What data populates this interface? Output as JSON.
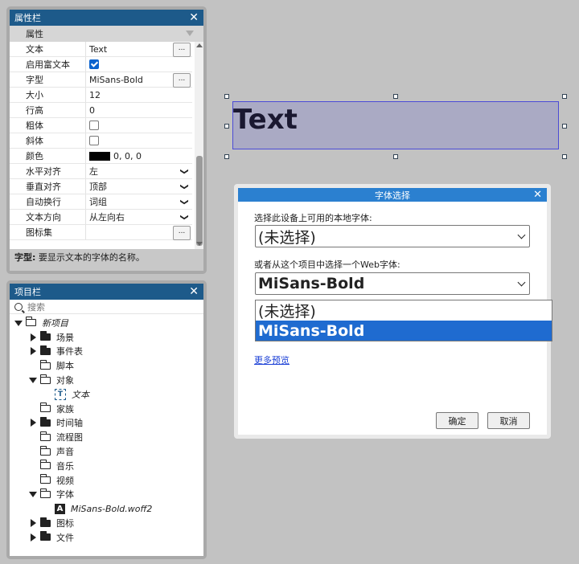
{
  "properties_panel": {
    "title": "属性栏",
    "header": "属性",
    "rows": [
      {
        "key": "文本",
        "value": "Text",
        "control": "button",
        "button": "..."
      },
      {
        "key": "启用富文本",
        "value": "",
        "control": "checkbox",
        "checked": true
      },
      {
        "key": "字型",
        "value": "MiSans-Bold",
        "control": "button",
        "button": "..."
      },
      {
        "key": "大小",
        "value": "12",
        "control": "none"
      },
      {
        "key": "行高",
        "value": "0",
        "control": "none"
      },
      {
        "key": "粗体",
        "value": "",
        "control": "checkbox",
        "checked": false
      },
      {
        "key": "斜体",
        "value": "",
        "control": "checkbox",
        "checked": false
      },
      {
        "key": "颜色",
        "value": "0, 0, 0",
        "control": "color",
        "color": "#000000"
      },
      {
        "key": "水平对齐",
        "value": "左",
        "control": "select"
      },
      {
        "key": "垂直对齐",
        "value": "顶部",
        "control": "select"
      },
      {
        "key": "自动换行",
        "value": "词组",
        "control": "select"
      },
      {
        "key": "文本方向",
        "value": "从左向右",
        "control": "select"
      },
      {
        "key": "图标集",
        "value": "",
        "control": "button",
        "button": "..."
      }
    ],
    "help_label": "字型:",
    "help_text": " 要显示文本的字体的名称。"
  },
  "project_panel": {
    "title": "项目栏",
    "search_placeholder": "搜索",
    "tree": [
      {
        "label": "新项目",
        "indent": 0,
        "toggle": "open",
        "icon": "folder",
        "italic": true
      },
      {
        "label": "场景",
        "indent": 1,
        "toggle": "closed",
        "icon": "folder-filled"
      },
      {
        "label": "事件表",
        "indent": 1,
        "toggle": "closed",
        "icon": "folder-filled"
      },
      {
        "label": "脚本",
        "indent": 1,
        "toggle": "none",
        "icon": "folder"
      },
      {
        "label": "对象",
        "indent": 1,
        "toggle": "open",
        "icon": "folder"
      },
      {
        "label": "文本",
        "indent": 2,
        "toggle": "none",
        "icon": "text-object",
        "italic": true
      },
      {
        "label": "家族",
        "indent": 1,
        "toggle": "none",
        "icon": "folder"
      },
      {
        "label": "时间轴",
        "indent": 1,
        "toggle": "closed",
        "icon": "folder-filled"
      },
      {
        "label": "流程图",
        "indent": 1,
        "toggle": "none",
        "icon": "folder"
      },
      {
        "label": "声音",
        "indent": 1,
        "toggle": "none",
        "icon": "folder"
      },
      {
        "label": "音乐",
        "indent": 1,
        "toggle": "none",
        "icon": "folder"
      },
      {
        "label": "视频",
        "indent": 1,
        "toggle": "none",
        "icon": "folder"
      },
      {
        "label": "字体",
        "indent": 1,
        "toggle": "open",
        "icon": "folder"
      },
      {
        "label": "MiSans-Bold.woff2",
        "indent": 2,
        "toggle": "none",
        "icon": "font-file",
        "italic": true
      },
      {
        "label": "图标",
        "indent": 1,
        "toggle": "closed",
        "icon": "folder-filled"
      },
      {
        "label": "文件",
        "indent": 1,
        "toggle": "closed",
        "icon": "folder-filled"
      }
    ]
  },
  "canvas": {
    "text_object": "Text"
  },
  "font_dialog": {
    "title": "字体选择",
    "local_label": "选择此设备上可用的本地字体:",
    "local_value": "(未选择)",
    "web_label": "或者从这个项目中选择一个Web字体:",
    "web_value": "MiSans-Bold",
    "web_options": [
      "(未选择)",
      "MiSans-Bold"
    ],
    "selected_option": "MiSans-Bold",
    "more_preview": "更多预览",
    "ok": "确定",
    "cancel": "取消"
  }
}
